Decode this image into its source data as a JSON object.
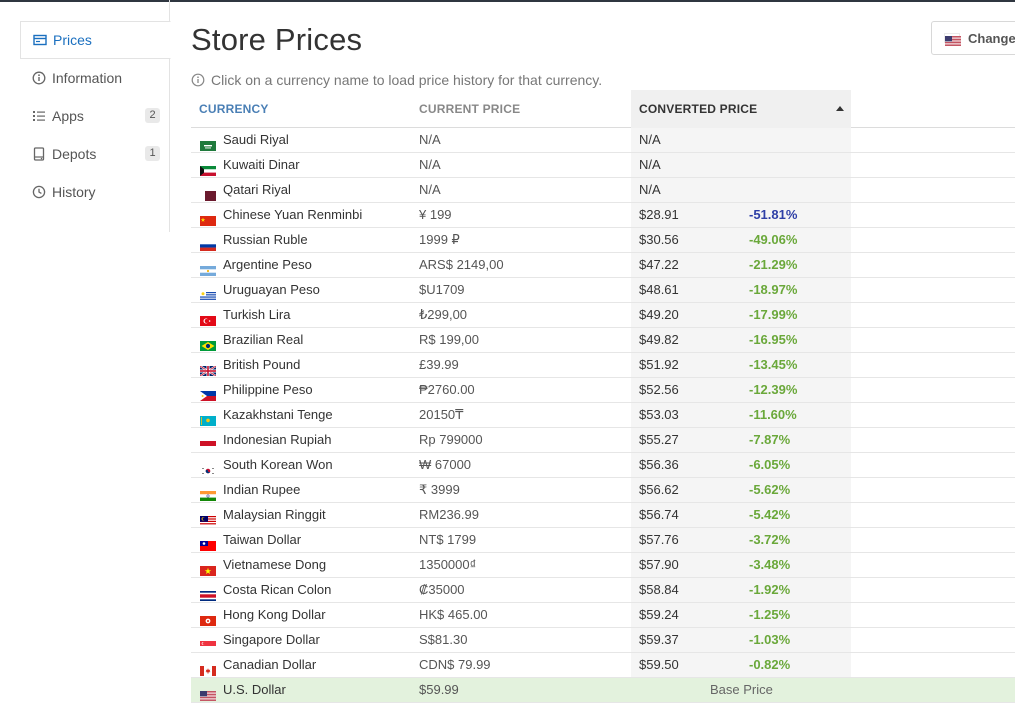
{
  "sidebar": {
    "items": [
      {
        "label": "Prices",
        "icon": "price-tag-icon",
        "active": true
      },
      {
        "label": "Information",
        "icon": "info-icon"
      },
      {
        "label": "Apps",
        "icon": "list-icon",
        "count": "2"
      },
      {
        "label": "Depots",
        "icon": "depot-icon",
        "count": "1"
      },
      {
        "label": "History",
        "icon": "history-icon"
      }
    ]
  },
  "header": {
    "title": "Store Prices",
    "hint": "Click on a currency name to load price history for that currency.",
    "change_label": "Change",
    "change_flag": "us-flag-icon"
  },
  "table": {
    "headers": {
      "currency": "CURRENCY",
      "current": "CURRENT PRICE",
      "converted": "CONVERTED PRICE"
    },
    "sort": "converted-ascending",
    "rows": [
      {
        "flag": "sa",
        "currency": "Saudi Riyal",
        "price": "N/A",
        "converted": "N/A",
        "diff": ""
      },
      {
        "flag": "kw",
        "currency": "Kuwaiti Dinar",
        "price": "N/A",
        "converted": "N/A",
        "diff": ""
      },
      {
        "flag": "qa",
        "currency": "Qatari Riyal",
        "price": "N/A",
        "converted": "N/A",
        "diff": ""
      },
      {
        "flag": "cn",
        "currency": "Chinese Yuan Renminbi",
        "price": "¥ 199",
        "converted": "$28.91",
        "diff": "-51.81%",
        "diff_style": "neg"
      },
      {
        "flag": "ru",
        "currency": "Russian Ruble",
        "price": "1999 ₽",
        "converted": "$30.56",
        "diff": "-49.06%",
        "diff_style": "pos"
      },
      {
        "flag": "ar",
        "currency": "Argentine Peso",
        "price": "ARS$ 2149,00",
        "converted": "$47.22",
        "diff": "-21.29%",
        "diff_style": "pos"
      },
      {
        "flag": "uy",
        "currency": "Uruguayan Peso",
        "price": "$U1709",
        "converted": "$48.61",
        "diff": "-18.97%",
        "diff_style": "pos"
      },
      {
        "flag": "tr",
        "currency": "Turkish Lira",
        "price": "₺299,00",
        "converted": "$49.20",
        "diff": "-17.99%",
        "diff_style": "pos"
      },
      {
        "flag": "br",
        "currency": "Brazilian Real",
        "price": "R$ 199,00",
        "converted": "$49.82",
        "diff": "-16.95%",
        "diff_style": "pos"
      },
      {
        "flag": "gb",
        "currency": "British Pound",
        "price": "£39.99",
        "converted": "$51.92",
        "diff": "-13.45%",
        "diff_style": "pos"
      },
      {
        "flag": "ph",
        "currency": "Philippine Peso",
        "price": "₱2760.00",
        "converted": "$52.56",
        "diff": "-12.39%",
        "diff_style": "pos"
      },
      {
        "flag": "kz",
        "currency": "Kazakhstani Tenge",
        "price": "20150₸",
        "converted": "$53.03",
        "diff": "-11.60%",
        "diff_style": "pos"
      },
      {
        "flag": "id",
        "currency": "Indonesian Rupiah",
        "price": "Rp 799000",
        "converted": "$55.27",
        "diff": "-7.87%",
        "diff_style": "pos"
      },
      {
        "flag": "kr",
        "currency": "South Korean Won",
        "price": "₩ 67000",
        "converted": "$56.36",
        "diff": "-6.05%",
        "diff_style": "pos"
      },
      {
        "flag": "in",
        "currency": "Indian Rupee",
        "price": "₹ 3999",
        "converted": "$56.62",
        "diff": "-5.62%",
        "diff_style": "pos"
      },
      {
        "flag": "my",
        "currency": "Malaysian Ringgit",
        "price": "RM236.99",
        "converted": "$56.74",
        "diff": "-5.42%",
        "diff_style": "pos"
      },
      {
        "flag": "tw",
        "currency": "Taiwan Dollar",
        "price": "NT$ 1799",
        "converted": "$57.76",
        "diff": "-3.72%",
        "diff_style": "pos"
      },
      {
        "flag": "vn",
        "currency": "Vietnamese Dong",
        "price": "1350000₫",
        "converted": "$57.90",
        "diff": "-3.48%",
        "diff_style": "pos"
      },
      {
        "flag": "cr",
        "currency": "Costa Rican Colon",
        "price": "₡35000",
        "converted": "$58.84",
        "diff": "-1.92%",
        "diff_style": "pos"
      },
      {
        "flag": "hk",
        "currency": "Hong Kong Dollar",
        "price": "HK$ 465.00",
        "converted": "$59.24",
        "diff": "-1.25%",
        "diff_style": "pos"
      },
      {
        "flag": "sg",
        "currency": "Singapore Dollar",
        "price": "S$81.30",
        "converted": "$59.37",
        "diff": "-1.03%",
        "diff_style": "pos"
      },
      {
        "flag": "ca",
        "currency": "Canadian Dollar",
        "price": "CDN$ 79.99",
        "converted": "$59.50",
        "diff": "-0.82%",
        "diff_style": "pos"
      },
      {
        "flag": "us",
        "currency": "U.S. Dollar",
        "price": "$59.99",
        "converted": "",
        "diff": "",
        "base": true,
        "base_label": "Base Price"
      }
    ]
  },
  "colors": {
    "accent": "#1a6fbf",
    "positive": "#6aa83a",
    "highlight": "#2e3fa6",
    "base_row": "#e3f2dd"
  }
}
